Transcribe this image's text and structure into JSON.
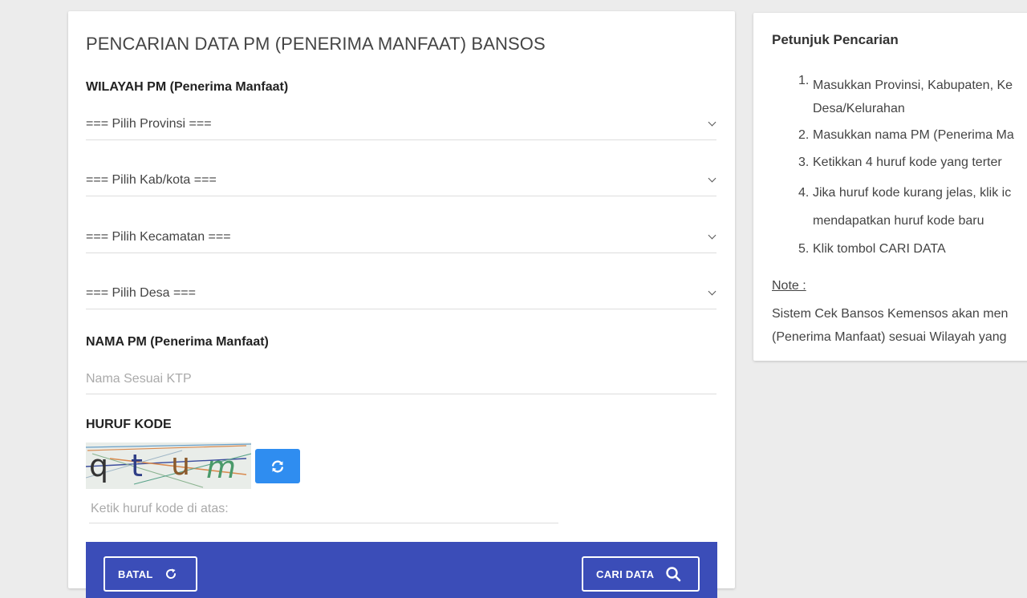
{
  "search_form": {
    "title": "PENCARIAN DATA PM (PENERIMA MANFAAT) BANSOS",
    "region_label": "WILAYAH PM (Penerima Manfaat)",
    "selects": {
      "province": "=== Pilih Provinsi ===",
      "regency": "=== Pilih Kab/kota ===",
      "district": "=== Pilih Kecamatan ===",
      "village": "=== Pilih Desa ==="
    },
    "name_label": "NAMA PM (Penerima Manfaat)",
    "name_placeholder": "Nama Sesuai KTP",
    "code_label": "HURUF KODE",
    "captcha_letters": [
      "q",
      "t",
      "u",
      "m"
    ],
    "code_placeholder": "Ketik huruf kode di atas:",
    "cancel_label": "BATAL",
    "search_label": "CARI DATA"
  },
  "guide": {
    "title": "Petunjuk Pencarian",
    "steps": [
      {
        "num": "1.",
        "lines": [
          "Masukkan Provinsi, Kabupaten, Ke",
          "Desa/Kelurahan"
        ]
      },
      {
        "num": "2.",
        "lines": [
          "Masukkan nama PM (Penerima Ma"
        ]
      },
      {
        "num": "3.",
        "lines": [
          "Ketikkan 4 huruf kode yang terter"
        ]
      },
      {
        "num": "4.",
        "lines": [
          "Jika huruf kode kurang jelas, klik ic",
          "mendapatkan huruf kode baru"
        ]
      },
      {
        "num": "5.",
        "lines": [
          "Klik tombol CARI DATA"
        ]
      }
    ],
    "note_label": "Note :",
    "note_lines": [
      "Sistem Cek Bansos Kemensos akan men",
      "(Penerima Manfaat) sesuai Wilayah yang"
    ]
  },
  "colors": {
    "page_background": "#ececec",
    "action_bar": "#3b4db8",
    "refresh_button": "#2f8df0"
  },
  "icons": {
    "refresh": "refresh-icon",
    "cancel": "reload-icon",
    "search": "search-icon"
  }
}
